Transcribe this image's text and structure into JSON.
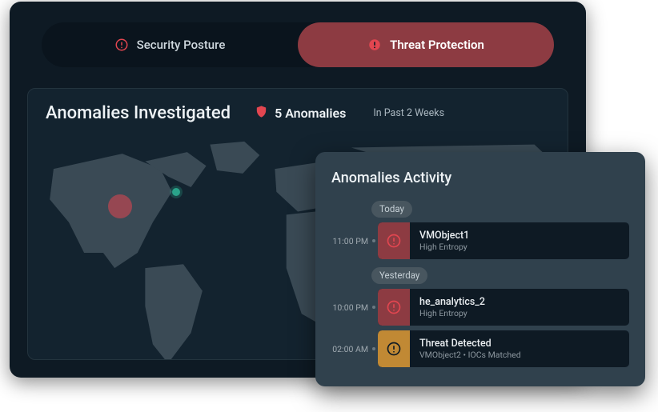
{
  "tabs": {
    "posture": "Security Posture",
    "threat": "Threat Protection",
    "active": "threat"
  },
  "anomalies": {
    "title": "Anomalies Investigated",
    "count_label": "5 Anomalies",
    "timeframe": "In Past 2 Weeks"
  },
  "colors": {
    "alert_red": "#e24650",
    "alert_amber": "#c18934",
    "bg_dark": "#0e1a24"
  },
  "activity": {
    "title": "Anomalies Activity",
    "groups": [
      {
        "label": "Today",
        "items": [
          {
            "time": "11:00 PM",
            "severity": "red",
            "name": "VMObject1",
            "sub": "High Entropy"
          }
        ]
      },
      {
        "label": "Yesterday",
        "items": [
          {
            "time": "10:00 PM",
            "severity": "red",
            "name": "he_analytics_2",
            "sub": "High Entropy"
          },
          {
            "time": "02:00 AM",
            "severity": "amber",
            "name": "Threat Detected",
            "sub": "VMObject2  •  IOCs Matched"
          }
        ]
      }
    ]
  }
}
